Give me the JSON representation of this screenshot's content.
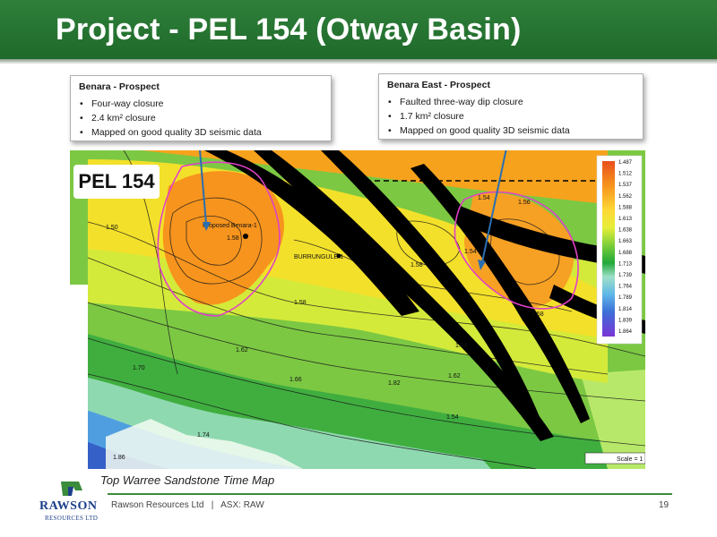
{
  "header": {
    "title": "Project - PEL 154 (Otway Basin)"
  },
  "callouts": [
    {
      "title": "Benara - Prospect",
      "bullets": [
        "Four-way closure",
        "2.4 km² closure",
        "Mapped on good quality 3D seismic data"
      ]
    },
    {
      "title": "Benara East - Prospect",
      "bullets": [
        "Faulted three-way dip closure",
        "1.7 km² closure",
        "Mapped on good quality 3D seismic data"
      ]
    }
  ],
  "map": {
    "pel_label": "PEL 154",
    "well_proposed": "Proposed Benara-1",
    "well_existing": "BURRUNGULE-1",
    "scale_label": "Scale = 1",
    "contour_labels": [
      "1.58",
      "1.58",
      "1.58",
      "1.58",
      "1.58",
      "1.62",
      "1.62",
      "1.66",
      "1.70",
      "1.74",
      "1.54",
      "1.56",
      "1.82",
      "1.86",
      "1.54",
      "1.54",
      "1.50"
    ],
    "legend_values": [
      "1.487",
      "1.512",
      "1.537",
      "1.562",
      "1.588",
      "1.613",
      "1.638",
      "1.663",
      "1.688",
      "1.713",
      "1.739",
      "1.764",
      "1.789",
      "1.814",
      "1.839",
      "1.864"
    ],
    "colors": {
      "fault": "#000000",
      "closure_outline": "#e040c8",
      "arrow": "#2a6fb0"
    }
  },
  "caption": "Top Warree Sandstone Time Map",
  "footer": {
    "company": "Rawson Resources Ltd",
    "separator": "|",
    "ticker": "ASX: RAW",
    "page": "19"
  },
  "logo": {
    "word": "RAWSON",
    "sub": "RESOURCES LTD"
  }
}
